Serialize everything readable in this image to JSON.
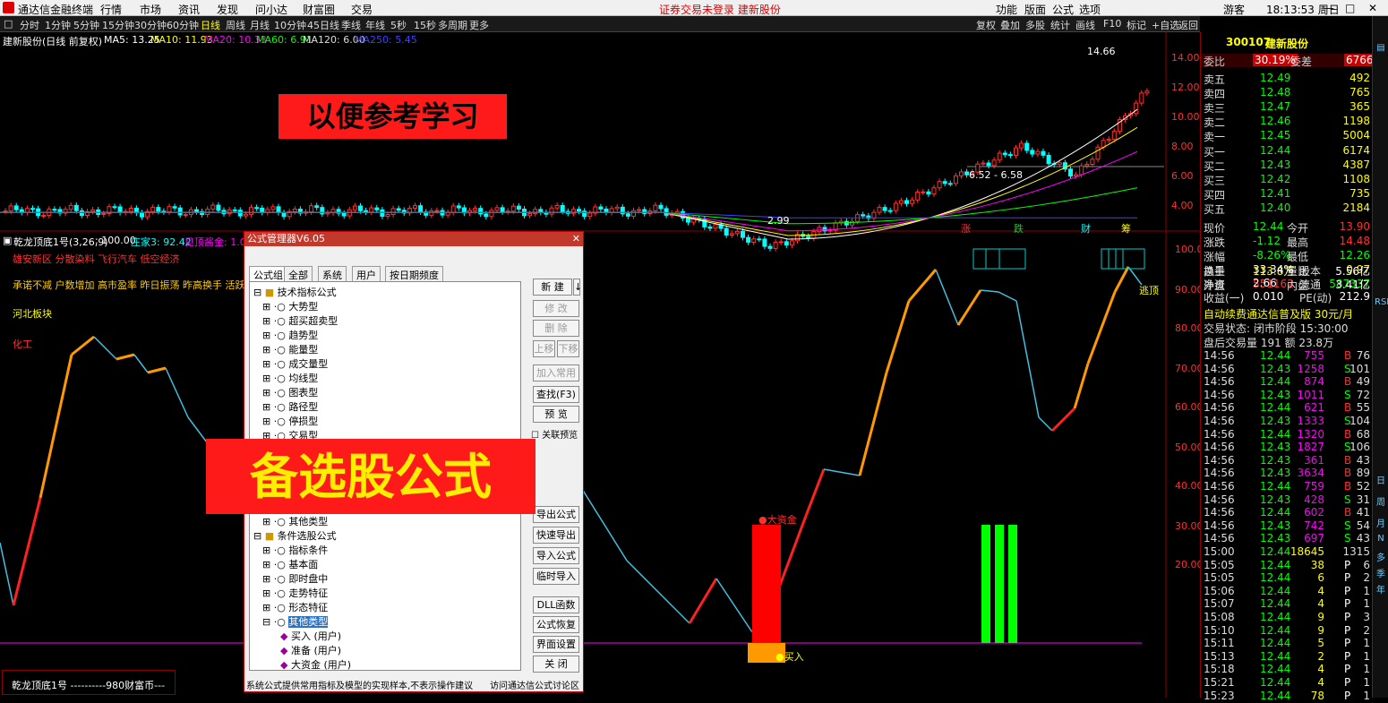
{
  "app": {
    "title": "通达信金融终端",
    "menu": [
      "行情",
      "市场",
      "资讯",
      "发现",
      "问小达",
      "财富圈",
      "交易"
    ],
    "notice": "证券交易未登录  建新股份",
    "right_menu": [
      "功能",
      "版面",
      "公式",
      "选项"
    ],
    "user": "游客",
    "time": "18:13:53 周日"
  },
  "periods": [
    "分时",
    "1分钟",
    "5分钟",
    "15分钟",
    "30分钟",
    "60分钟",
    "日线",
    "周线",
    "月线",
    "10分钟",
    "45日线",
    "季线",
    "年线",
    "5秒",
    "15秒",
    "多周期",
    "更多"
  ],
  "active_period": "日线",
  "chart_tools": [
    "复权",
    "叠加",
    "多股",
    "统计",
    "画线",
    "F10",
    "标记",
    "+自选",
    "返回"
  ],
  "ma_line": {
    "stock": "建新股份(日线 前复权)",
    "ma5": "MA5: 13.25",
    "ma10": "MA10: 11.93",
    "ma20": "MA20: 10.33",
    "ma60": "MA60: 6.91",
    "ma120": "MA120: 6.00",
    "ma250": "MA250: 5.45"
  },
  "price_axis": [
    "14.00",
    "12.00",
    "10.00",
    "8.00",
    "6.00",
    "4.00"
  ],
  "price_annotations": {
    "high": "14.66",
    "low": "2.99",
    "range": "6.52 - 6.58"
  },
  "event_markers": [
    "涨",
    "跌",
    "财",
    "筹"
  ],
  "indicator_line": {
    "name": "乾龙顶底1号(3,26,9)",
    "v1": ": 100.00",
    "v2": "庄家3: 92.42",
    "v3": "见顶酱金: 1.00"
  },
  "indicator_axis": [
    "100.0",
    "90.00",
    "80.00",
    "70.00",
    "60.00",
    "50.00",
    "40.00",
    "30.00",
    "20.00"
  ],
  "left_tags": [
    "雄安新区 分散染料 飞行汽车 低空经济",
    "承诺不减 户数增加 高市盈率 昨日振荡 昨高换手 活跃股 近期",
    "河北板块",
    "化工"
  ],
  "signal_labels": {
    "top": "逃顶",
    "big_money": "●大资金",
    "buy": "●买入"
  },
  "footer_left": "乾龙顶底1号 ----------980财富币---",
  "banners": {
    "top": "以便参考学习",
    "mid": "备选股公式"
  },
  "dialog": {
    "title": "公式管理器V6.05",
    "tabs": [
      "公式组",
      "全部",
      "系统",
      "用户",
      "按日期频度"
    ],
    "tree_top": "技术指标公式",
    "tree_items": [
      "大势型",
      "超买超卖型",
      "趋势型",
      "能量型",
      "成交量型",
      "均线型",
      "图表型",
      "路径型",
      "停损型",
      "交易型"
    ],
    "tree_other": "其他类型",
    "tree_cond": "条件选股公式",
    "cond_items": [
      "指标条件",
      "基本面",
      "即时盘中",
      "走势特征",
      "形态特征"
    ],
    "cond_sel": "其他类型",
    "user_items": [
      "买入 (用户)",
      "准备 (用户)",
      "大资金 (用户)"
    ],
    "buttons": [
      "新 建",
      "修 改",
      "删 除",
      "上移",
      "下移",
      "加入常用",
      "查找(F3)",
      "预 览",
      "导出公式",
      "快速导出",
      "导入公式",
      "临时导入",
      "DLL函数",
      "公式恢复",
      "界面设置",
      "关 闭"
    ],
    "checkbox": "关联预览",
    "status": "系统公式提供常用指标及模型的实现样本,不表示操作建议",
    "link": "访问通达信公式讨论区"
  },
  "quote": {
    "code": "300107",
    "name": "建新股份",
    "weibi_label": "委比",
    "weibi": "30.19%",
    "weicha_label": "委差",
    "weicha": "6766",
    "asks": [
      {
        "label": "卖五",
        "price": "12.49",
        "vol": "492"
      },
      {
        "label": "卖四",
        "price": "12.48",
        "vol": "765"
      },
      {
        "label": "卖三",
        "price": "12.47",
        "vol": "365"
      },
      {
        "label": "卖二",
        "price": "12.46",
        "vol": "1198"
      },
      {
        "label": "卖一",
        "price": "12.45",
        "vol": "5004"
      }
    ],
    "bids": [
      {
        "label": "买一",
        "price": "12.44",
        "vol": "6174"
      },
      {
        "label": "买二",
        "price": "12.43",
        "vol": "4387"
      },
      {
        "label": "买三",
        "price": "12.42",
        "vol": "1108"
      },
      {
        "label": "买四",
        "price": "12.41",
        "vol": "735"
      },
      {
        "label": "买五",
        "price": "12.40",
        "vol": "2184"
      }
    ],
    "stats": [
      {
        "l1": "现价",
        "v1": "12.44",
        "l2": "今开",
        "v2": "13.90"
      },
      {
        "l1": "涨跌",
        "v1": "-1.12",
        "l2": "最高",
        "v2": "14.48"
      },
      {
        "l1": "涨幅",
        "v1": "-8.26%",
        "l2": "最低",
        "v2": "12.26"
      },
      {
        "l1": "总量",
        "v1": "113.8万",
        "l2": "量比",
        "v2": "0.97"
      },
      {
        "l1": "外盘",
        "v1": "551162",
        "l2": "内盘",
        "v2": "587337"
      }
    ],
    "stats2": [
      {
        "l1": "换手",
        "v1": "33.34%",
        "l2": "股本",
        "v2": "5.56亿"
      },
      {
        "l1": "净资",
        "v1": "2.66",
        "l2": "流通",
        "v2": "3.41亿"
      },
      {
        "l1": "收益(一)",
        "v1": "0.010",
        "l2": "PE(动)",
        "v2": "212.9"
      }
    ],
    "ad": "自动续费通达信普及版 30元/月",
    "trade_status": "交易状态: 闭市阶段 15:30:00",
    "after_hours": "盘后交易量 191 额 23.8万",
    "ticks": [
      {
        "t": "14:56",
        "p": "12.44",
        "v": "755",
        "d": "B",
        "n": "76"
      },
      {
        "t": "14:56",
        "p": "12.43",
        "v": "1258",
        "d": "S",
        "n": "101"
      },
      {
        "t": "14:56",
        "p": "12.44",
        "v": "874",
        "d": "B",
        "n": "49"
      },
      {
        "t": "14:56",
        "p": "12.43",
        "v": "1011",
        "d": "S",
        "n": "72"
      },
      {
        "t": "14:56",
        "p": "12.44",
        "v": "621",
        "d": "B",
        "n": "55"
      },
      {
        "t": "14:56",
        "p": "12.43",
        "v": "1333",
        "d": "S",
        "n": "104"
      },
      {
        "t": "14:56",
        "p": "12.44",
        "v": "1320",
        "d": "B",
        "n": "68"
      },
      {
        "t": "14:56",
        "p": "12.43",
        "v": "1827",
        "d": "S",
        "n": "106"
      },
      {
        "t": "14:56",
        "p": "12.43",
        "v": "361",
        "d": "B",
        "n": "43"
      },
      {
        "t": "14:56",
        "p": "12.43",
        "v": "3634",
        "d": "B",
        "n": "89"
      },
      {
        "t": "14:56",
        "p": "12.44",
        "v": "759",
        "d": "B",
        "n": "52"
      },
      {
        "t": "14:56",
        "p": "12.43",
        "v": "428",
        "d": "S",
        "n": "31"
      },
      {
        "t": "14:56",
        "p": "12.44",
        "v": "602",
        "d": "B",
        "n": "41"
      },
      {
        "t": "14:56",
        "p": "12.43",
        "v": "742",
        "d": "S",
        "n": "54"
      },
      {
        "t": "14:56",
        "p": "12.43",
        "v": "697",
        "d": "S",
        "n": "43"
      },
      {
        "t": "15:00",
        "p": "12.44",
        "v": "18645",
        "d": "",
        "n": "1315"
      },
      {
        "t": "15:05",
        "p": "12.44",
        "v": "38",
        "d": "P",
        "n": "6"
      },
      {
        "t": "15:05",
        "p": "12.44",
        "v": "6",
        "d": "P",
        "n": "2"
      },
      {
        "t": "15:06",
        "p": "12.44",
        "v": "4",
        "d": "P",
        "n": "1"
      },
      {
        "t": "15:07",
        "p": "12.44",
        "v": "4",
        "d": "P",
        "n": "1"
      },
      {
        "t": "15:08",
        "p": "12.44",
        "v": "9",
        "d": "P",
        "n": "3"
      },
      {
        "t": "15:10",
        "p": "12.44",
        "v": "9",
        "d": "P",
        "n": "2"
      },
      {
        "t": "15:11",
        "p": "12.44",
        "v": "5",
        "d": "P",
        "n": "1"
      },
      {
        "t": "15:13",
        "p": "12.44",
        "v": "2",
        "d": "P",
        "n": "1"
      },
      {
        "t": "15:18",
        "p": "12.44",
        "v": "4",
        "d": "P",
        "n": "1"
      },
      {
        "t": "15:21",
        "p": "12.44",
        "v": "4",
        "d": "P",
        "n": "1"
      },
      {
        "t": "15:23",
        "p": "12.44",
        "v": "78",
        "d": "P",
        "n": "1"
      }
    ]
  },
  "side_icons": [
    "RSI",
    "日",
    "周",
    "月",
    "N",
    "多",
    "季",
    "年"
  ]
}
